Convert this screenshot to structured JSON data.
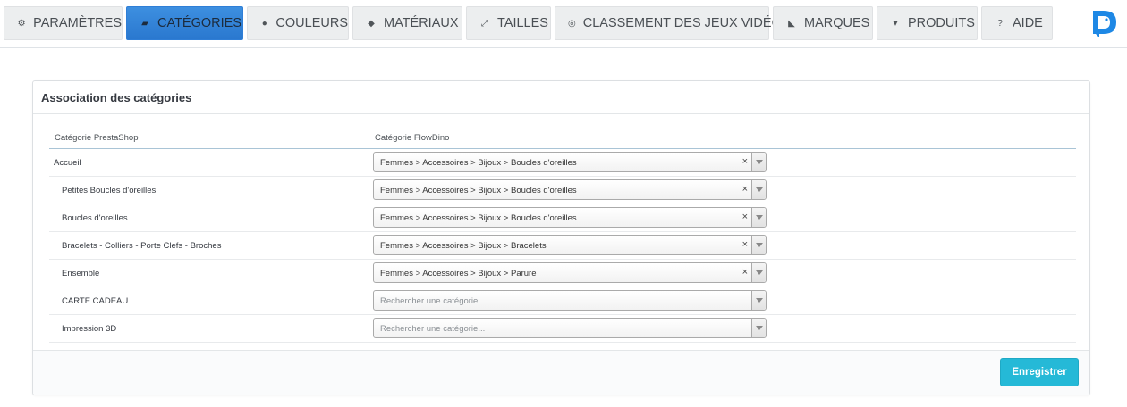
{
  "tabs": [
    {
      "label": "PARAMÈTRES",
      "icon": "gears-icon",
      "glyph": "⚙",
      "active": false
    },
    {
      "label": "CATÉGORIES",
      "icon": "folder-open-icon",
      "glyph": "▰",
      "active": true
    },
    {
      "label": "COULEURS",
      "icon": "drop-icon",
      "glyph": "●",
      "active": false
    },
    {
      "label": "MATÉRIAUX",
      "icon": "cube-icon",
      "glyph": "◆",
      "active": false
    },
    {
      "label": "TAILLES",
      "icon": "expand-icon",
      "glyph": "⤢",
      "active": false
    },
    {
      "label": "CLASSEMENT DES JEUX VIDÉO",
      "icon": "gamepad-icon",
      "glyph": "◎",
      "active": false
    },
    {
      "label": "MARQUES",
      "icon": "tag-icon",
      "glyph": "◣",
      "active": false
    },
    {
      "label": "PRODUITS",
      "icon": "cart-icon",
      "glyph": "▾",
      "active": false
    },
    {
      "label": "AIDE",
      "icon": "question-icon",
      "glyph": "?",
      "active": false
    }
  ],
  "logo": {
    "icon": "flowdino-logo-icon",
    "color": "#1e88e5"
  },
  "panel": {
    "title": "Association des catégories",
    "col_prestashop": "Catégorie PrestaShop",
    "col_flowdino": "Catégorie FlowDino",
    "rows": [
      {
        "name": "Accueil",
        "value": "Femmes > Accessoires > Bijoux > Boucles d'oreilles",
        "placeholder": false,
        "indent": false
      },
      {
        "name": "Petites Boucles d'oreilles",
        "value": "Femmes > Accessoires > Bijoux > Boucles d'oreilles",
        "placeholder": false,
        "indent": true
      },
      {
        "name": "Boucles d'oreilles",
        "value": "Femmes > Accessoires > Bijoux > Boucles d'oreilles",
        "placeholder": false,
        "indent": true
      },
      {
        "name": "Bracelets - Colliers - Porte Clefs - Broches",
        "value": "Femmes > Accessoires > Bijoux > Bracelets",
        "placeholder": false,
        "indent": true
      },
      {
        "name": "Ensemble",
        "value": "Femmes > Accessoires > Bijoux > Parure",
        "placeholder": false,
        "indent": true
      },
      {
        "name": "CARTE CADEAU",
        "value": "Rechercher une catégorie...",
        "placeholder": true,
        "indent": true
      },
      {
        "name": "Impression 3D",
        "value": "Rechercher une catégorie...",
        "placeholder": true,
        "indent": true
      }
    ],
    "clear_glyph": "×",
    "save_label": "Enregistrer"
  },
  "colors": {
    "accent": "#25b9d7",
    "active_tab": "#2a78cf"
  }
}
